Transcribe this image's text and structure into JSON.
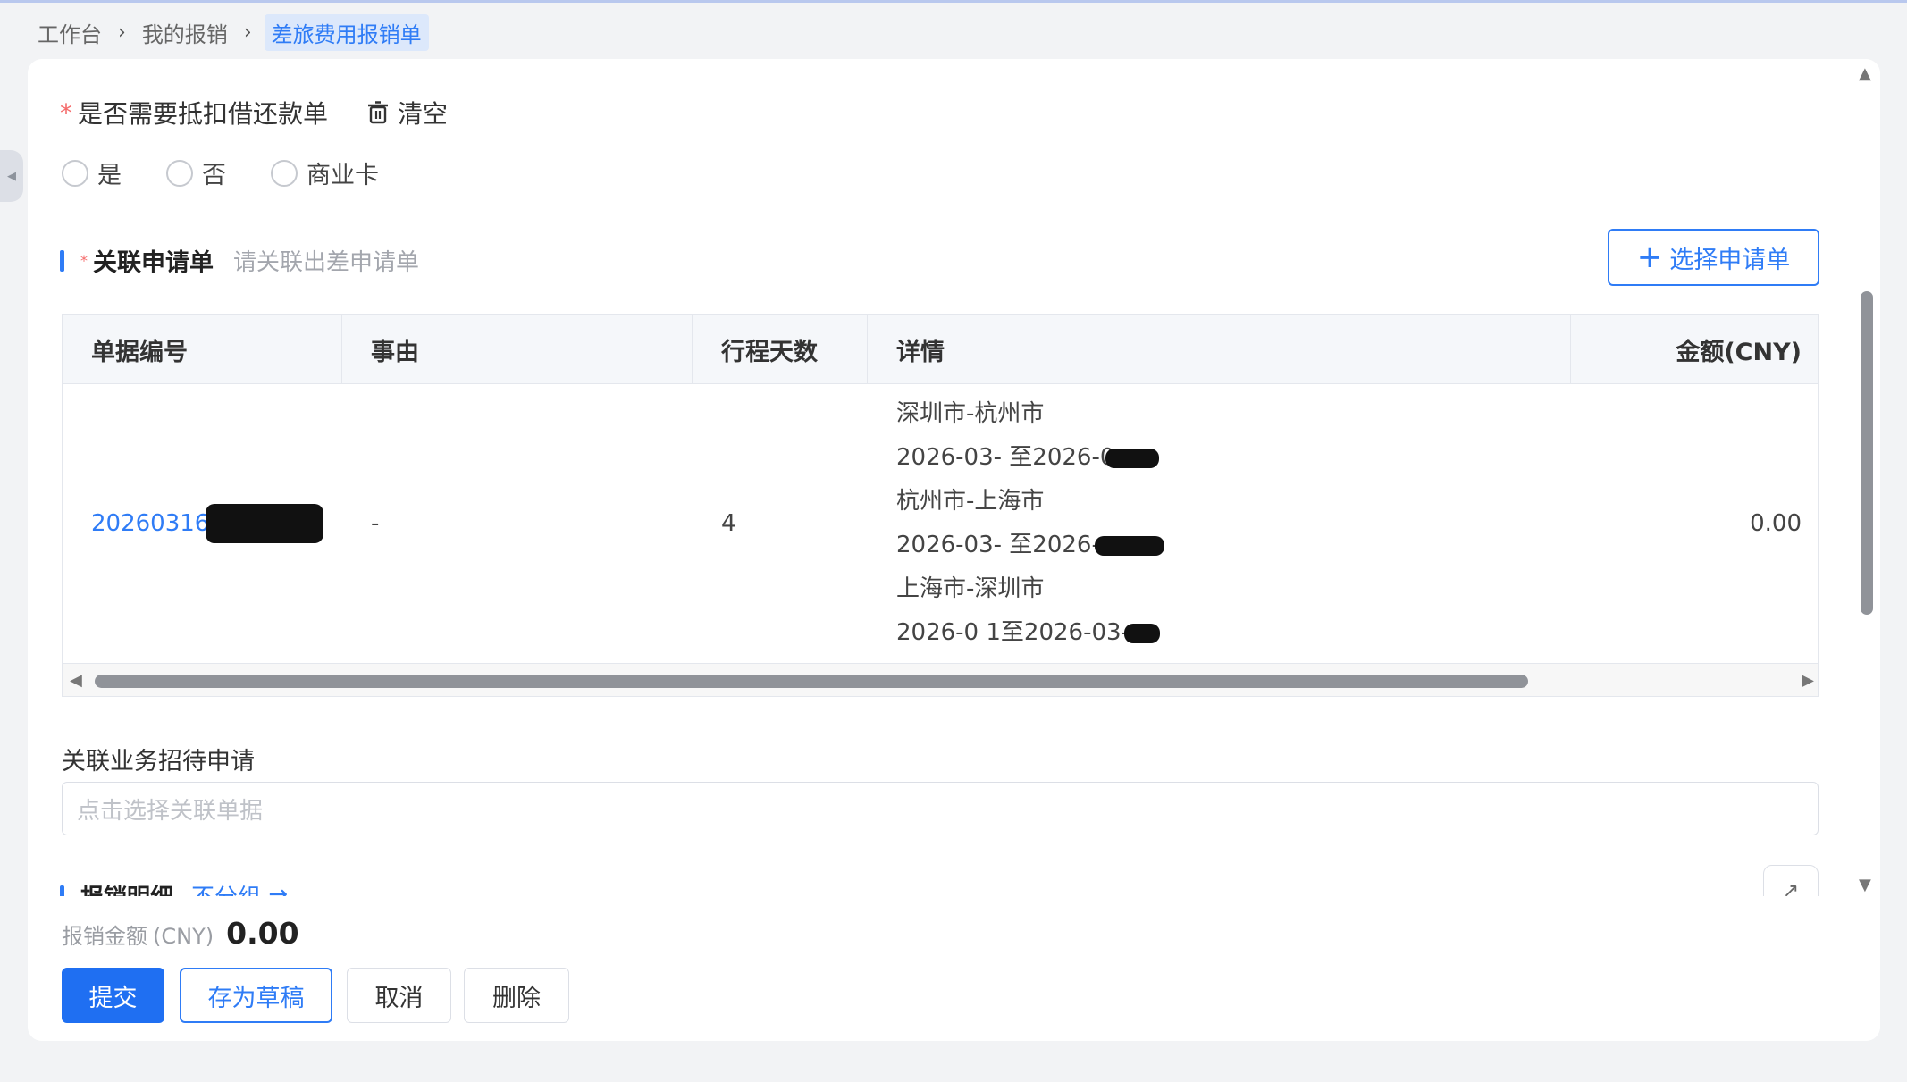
{
  "breadcrumb": {
    "items": [
      "工作台",
      "我的报销"
    ],
    "current": "差旅费用报销单"
  },
  "form": {
    "deduct_question": "是否需要抵扣借还款单",
    "clear_label": "清空",
    "radio_options": [
      "是",
      "否",
      "商业卡"
    ],
    "related_application": {
      "title": "关联申请单",
      "hint": "请关联出差申请单",
      "select_button": "选择申请单"
    },
    "table": {
      "columns": [
        "单据编号",
        "事由",
        "行程天数",
        "详情",
        "金额(CNY)"
      ],
      "rows": [
        {
          "doc_no": "20260316",
          "reason": "-",
          "days": "4",
          "details": [
            {
              "route": "深圳市-杭州市",
              "dates": "2026-03-  至2026-0"
            },
            {
              "route": "杭州市-上海市",
              "dates": "2026-03-  至2026-"
            },
            {
              "route": "上海市-深圳市",
              "dates": "2026-0  1至2026-03-"
            }
          ],
          "amount": "0.00"
        }
      ]
    },
    "business_entertainment": {
      "label": "关联业务招待申请",
      "placeholder": "点击选择关联单据"
    },
    "expense_detail": {
      "title": "报销明细",
      "group_label": "不分组 ⇄"
    }
  },
  "footer": {
    "amount_label": "报销金额",
    "amount_unit": "(CNY)",
    "amount_value": "0.00",
    "buttons": {
      "submit": "提交",
      "draft": "存为草稿",
      "cancel": "取消",
      "delete": "删除"
    }
  },
  "colors": {
    "primary": "#1f6ff2",
    "link": "#2f7cf6",
    "required": "#f56c6c",
    "breadcrumb_active_bg": "#dce8fb"
  },
  "icons": [
    "chevron-right-icon",
    "trash-icon",
    "plus-icon",
    "expand-icon",
    "collapse-left-icon",
    "scroll-arrow-icons"
  ]
}
